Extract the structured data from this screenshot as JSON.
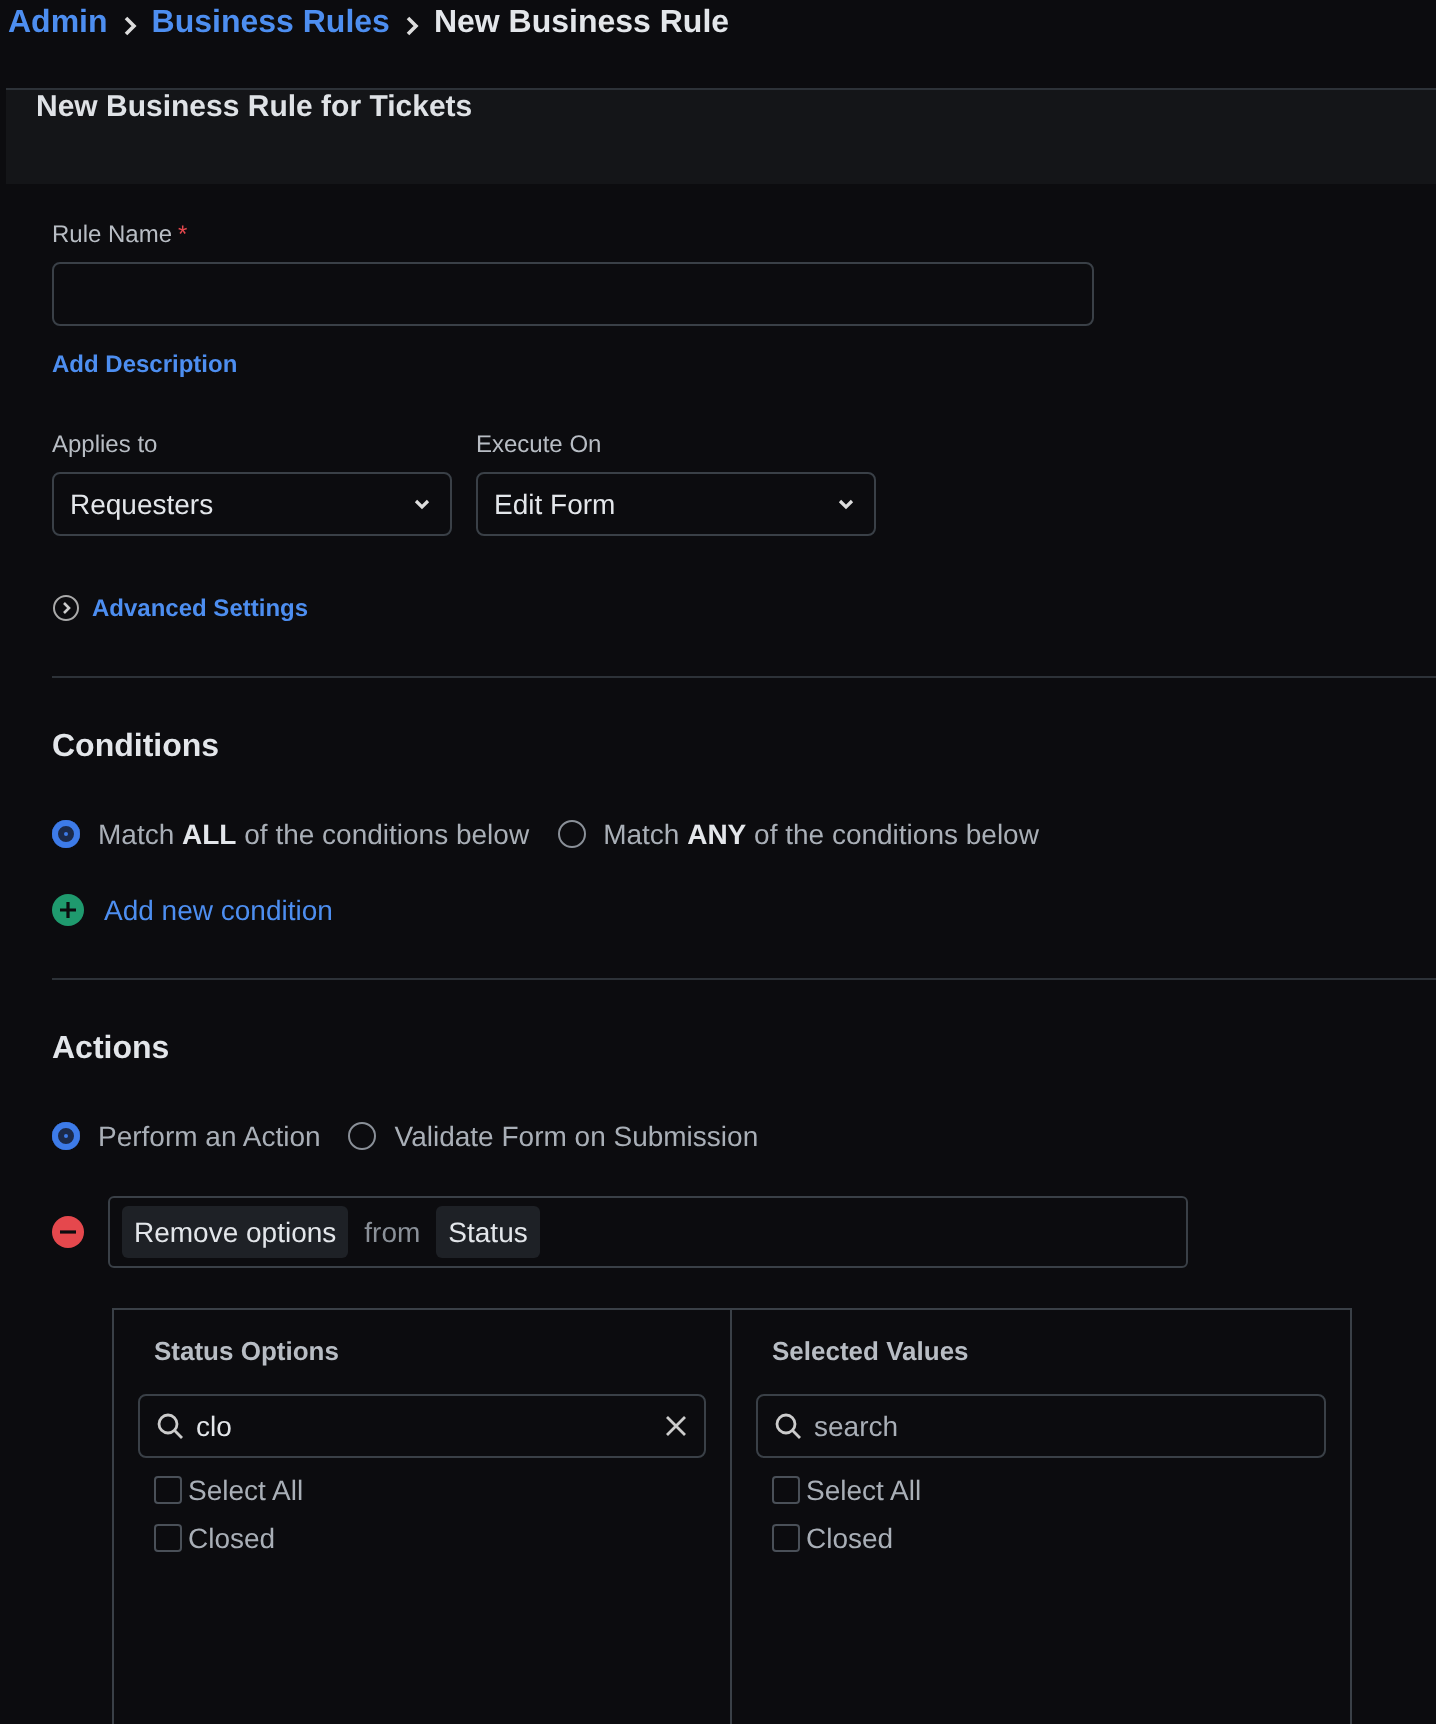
{
  "breadcrumb": [
    {
      "label": "Admin",
      "link": true
    },
    {
      "label": "Business Rules",
      "link": true
    },
    {
      "label": "New Business Rule",
      "link": false
    }
  ],
  "header": {
    "title": "New Business Rule for Tickets"
  },
  "rule_name": {
    "label": "Rule Name",
    "required_mark": "*"
  },
  "add_description": "Add Description",
  "selects": [
    {
      "label": "Applies to",
      "value": "Requesters"
    },
    {
      "label": "Execute On",
      "value": "Edit Form"
    }
  ],
  "advanced_settings": {
    "label": "Advanced Settings",
    "expanded": false
  },
  "conditions": {
    "title": "Conditions",
    "options": [
      {
        "label": "Match **ALL** of the conditions below",
        "selected": true
      },
      {
        "label": "Match **ANY** of the conditions below",
        "selected": false
      }
    ],
    "add_label": "Add new condition"
  },
  "actions": {
    "title": "Actions",
    "options": [
      {
        "label": "Perform an Action",
        "selected": true
      },
      {
        "label": "Validate Form on Submission",
        "selected": false
      }
    ],
    "action_row": {
      "verb": "Remove options",
      "joiner": "from",
      "field": "Status"
    },
    "panels": [
      {
        "title": "Status Options",
        "search_value": "clo",
        "items": [
          {
            "label": "Select All",
            "checked": false
          },
          {
            "label": "Closed",
            "checked": false
          }
        ]
      },
      {
        "title": "Selected Values",
        "placeholder": "search",
        "items": [
          {
            "label": "Select All",
            "checked": false
          },
          {
            "label": "Closed",
            "checked": false
          }
        ]
      }
    ]
  }
}
